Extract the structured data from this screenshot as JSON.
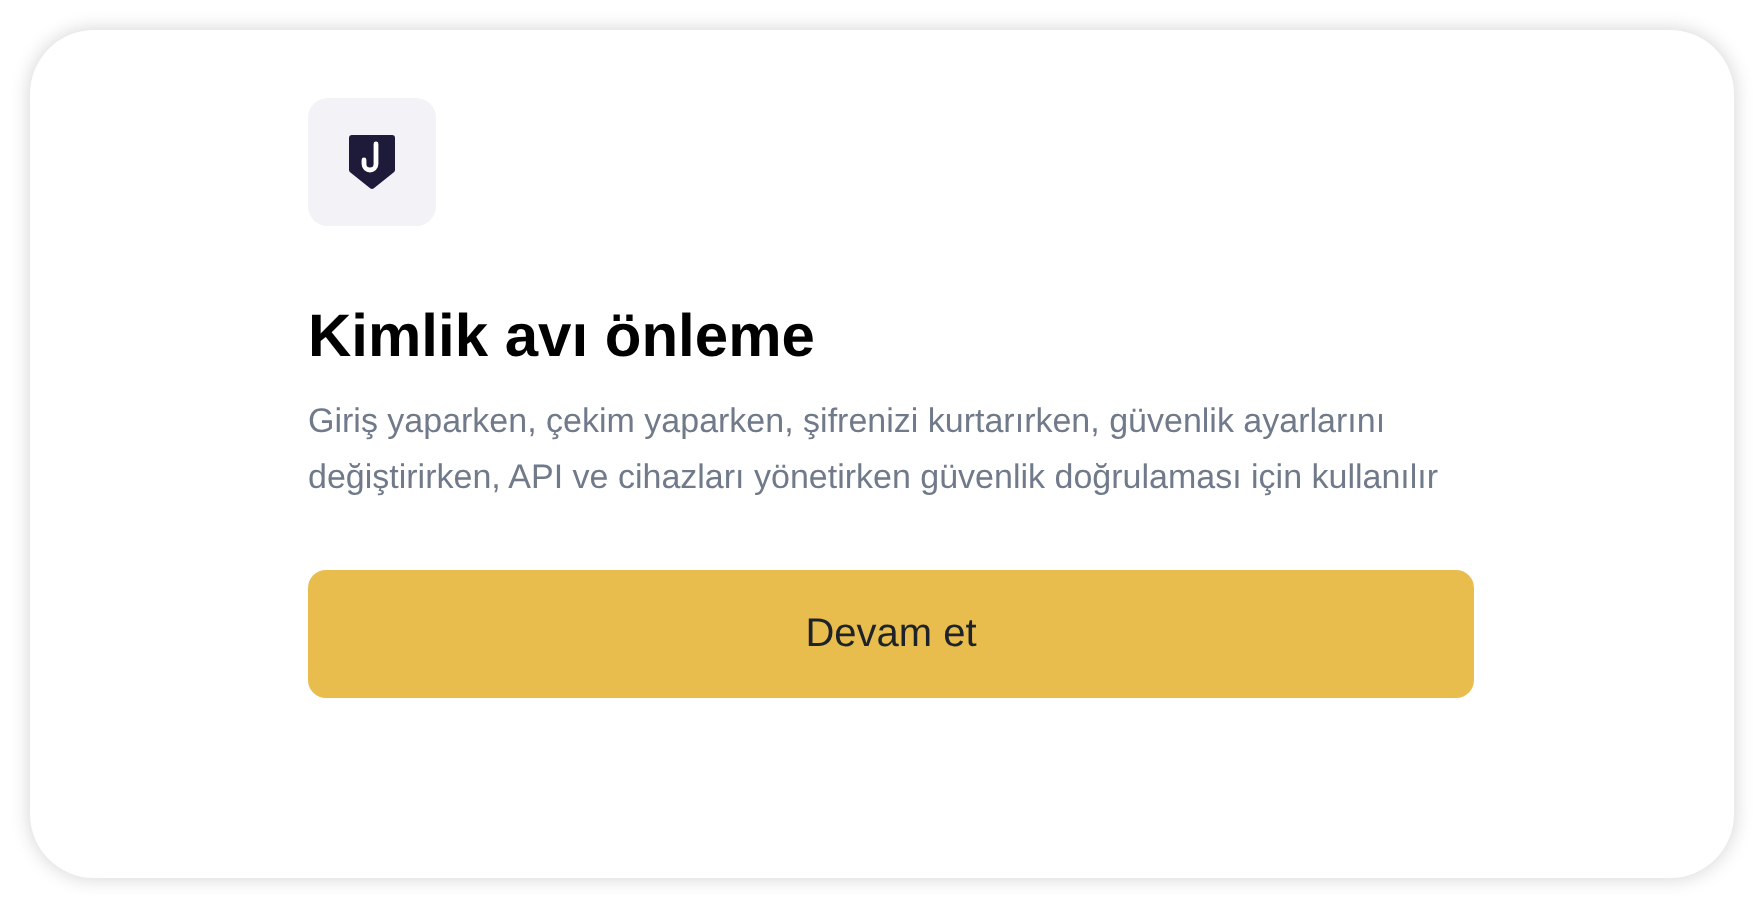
{
  "title": "Kimlik avı önleme",
  "description": "Giriş yaparken, çekim yaparken, şifrenizi kurtarırken, güvenlik ayarlarını değiştirirken, API ve cihazları yönetirken güvenlik doğrulaması için kullanılır",
  "button": "Devam et"
}
